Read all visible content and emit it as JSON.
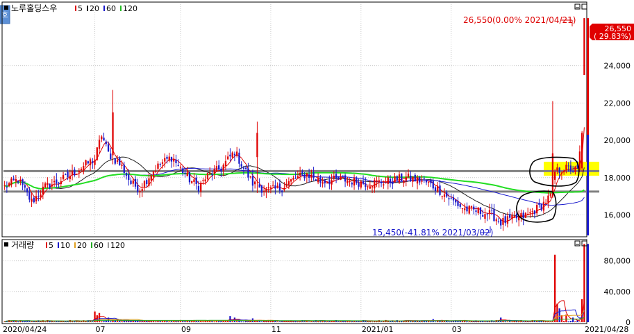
{
  "price_panel": {
    "legend_name": "노루홀딩스우",
    "ma_legend": [
      {
        "label": "5",
        "color": "#dd0000"
      },
      {
        "label": "20",
        "color": "#222222"
      },
      {
        "label": "60",
        "color": "#1a1acc"
      },
      {
        "label": "120",
        "color": "#22bb22"
      }
    ],
    "high_annotation": "26,550(0.00% 2021/04/21)",
    "low_annotation": "15,450(-41.81% 2021/03/02)",
    "current_price": "26,550",
    "current_change": "( 29.83%)",
    "side_tab_label": "호"
  },
  "volume_panel": {
    "legend_name": "거래량",
    "ma_legend": [
      {
        "label": "5",
        "color": "#dd0000"
      },
      {
        "label": "10",
        "color": "#1a1acc"
      },
      {
        "label": "20",
        "color": "#e0a020"
      },
      {
        "label": "60",
        "color": "#22aa22"
      },
      {
        "label": "120",
        "color": "#999999"
      }
    ]
  },
  "x_axis": {
    "date_labels": [
      "2020/04/24",
      "07",
      "09",
      "11",
      "2021/01",
      "03",
      "2021/04/28"
    ]
  },
  "colors": {
    "up": "#e00000",
    "down": "#1a1acc",
    "highlight": "#ffff00",
    "support_line": "#808080"
  },
  "chart_data": [
    {
      "type": "candlestick",
      "title": "노루홀딩스우",
      "y_ticks": [
        16000,
        18000,
        20000,
        22000,
        24000
      ],
      "ylim": [
        14900,
        27300
      ],
      "horizontal_levels": [
        18350,
        17250
      ],
      "highlight_band": [
        18100,
        18850
      ],
      "ohlc_keypoints": [
        {
          "t": 0,
          "price": 17500
        },
        {
          "t": 6,
          "price": 17900
        },
        {
          "t": 12,
          "price": 16700
        },
        {
          "t": 18,
          "price": 17500
        },
        {
          "t": 24,
          "price": 17800
        },
        {
          "t": 30,
          "price": 18200
        },
        {
          "t": 36,
          "price": 18700
        },
        {
          "t": 40,
          "price": 19000
        },
        {
          "t": 43,
          "price": 20300
        },
        {
          "t": 46,
          "price": 19300
        },
        {
          "t": 52,
          "price": 18600
        },
        {
          "t": 56,
          "price": 17700
        },
        {
          "t": 60,
          "price": 17400
        },
        {
          "t": 66,
          "price": 18400
        },
        {
          "t": 70,
          "price": 18800
        },
        {
          "t": 74,
          "price": 19100
        },
        {
          "t": 78,
          "price": 18500
        },
        {
          "t": 82,
          "price": 17900
        },
        {
          "t": 86,
          "price": 17500
        },
        {
          "t": 90,
          "price": 18100
        },
        {
          "t": 96,
          "price": 18500
        },
        {
          "t": 102,
          "price": 19400
        },
        {
          "t": 106,
          "price": 18500
        },
        {
          "t": 110,
          "price": 17700
        },
        {
          "t": 116,
          "price": 17300
        },
        {
          "t": 122,
          "price": 17400
        },
        {
          "t": 128,
          "price": 17900
        },
        {
          "t": 134,
          "price": 18200
        },
        {
          "t": 140,
          "price": 17800
        },
        {
          "t": 150,
          "price": 17900
        },
        {
          "t": 160,
          "price": 17700
        },
        {
          "t": 170,
          "price": 17800
        },
        {
          "t": 178,
          "price": 18000
        },
        {
          "t": 186,
          "price": 17800
        },
        {
          "t": 192,
          "price": 17400
        },
        {
          "t": 198,
          "price": 16800
        },
        {
          "t": 204,
          "price": 16300
        },
        {
          "t": 210,
          "price": 16200
        },
        {
          "t": 216,
          "price": 16000
        },
        {
          "t": 220,
          "price": 15600
        },
        {
          "t": 226,
          "price": 15800
        },
        {
          "t": 232,
          "price": 16000
        },
        {
          "t": 238,
          "price": 16500
        },
        {
          "t": 242,
          "price": 17000
        },
        {
          "t": 244,
          "price": 18300
        },
        {
          "t": 248,
          "price": 18500
        },
        {
          "t": 254,
          "price": 18400
        },
        {
          "t": 256,
          "price": 20400
        },
        {
          "t": 257,
          "price": 26550
        }
      ],
      "ma_lines": [
        {
          "name": "5",
          "period": 5,
          "color": "#dd0000"
        },
        {
          "name": "20",
          "period": 20,
          "color": "#222222"
        },
        {
          "name": "60",
          "period": 60,
          "color": "#1a1acc"
        },
        {
          "name": "120",
          "period": 120,
          "color": "#22dd22"
        }
      ]
    },
    {
      "type": "bar",
      "title": "거래량",
      "y_ticks": [
        0,
        40000,
        80000
      ],
      "ylim": [
        0,
        105000
      ],
      "baseline_volume": 1800,
      "volume_spikes": [
        {
          "t": 40,
          "value": 14000
        },
        {
          "t": 41,
          "value": 9000
        },
        {
          "t": 42,
          "value": 12000
        },
        {
          "t": 46,
          "value": 6000
        },
        {
          "t": 100,
          "value": 8000
        },
        {
          "t": 102,
          "value": 6000
        },
        {
          "t": 110,
          "value": 5000
        },
        {
          "t": 190,
          "value": 4000
        },
        {
          "t": 220,
          "value": 6000
        },
        {
          "t": 244,
          "value": 88000
        },
        {
          "t": 245,
          "value": 24000
        },
        {
          "t": 246,
          "value": 18000
        },
        {
          "t": 247,
          "value": 9000
        },
        {
          "t": 249,
          "value": 10000
        },
        {
          "t": 252,
          "value": 6000
        },
        {
          "t": 256,
          "value": 30000
        },
        {
          "t": 257,
          "value": 102000
        }
      ]
    }
  ]
}
